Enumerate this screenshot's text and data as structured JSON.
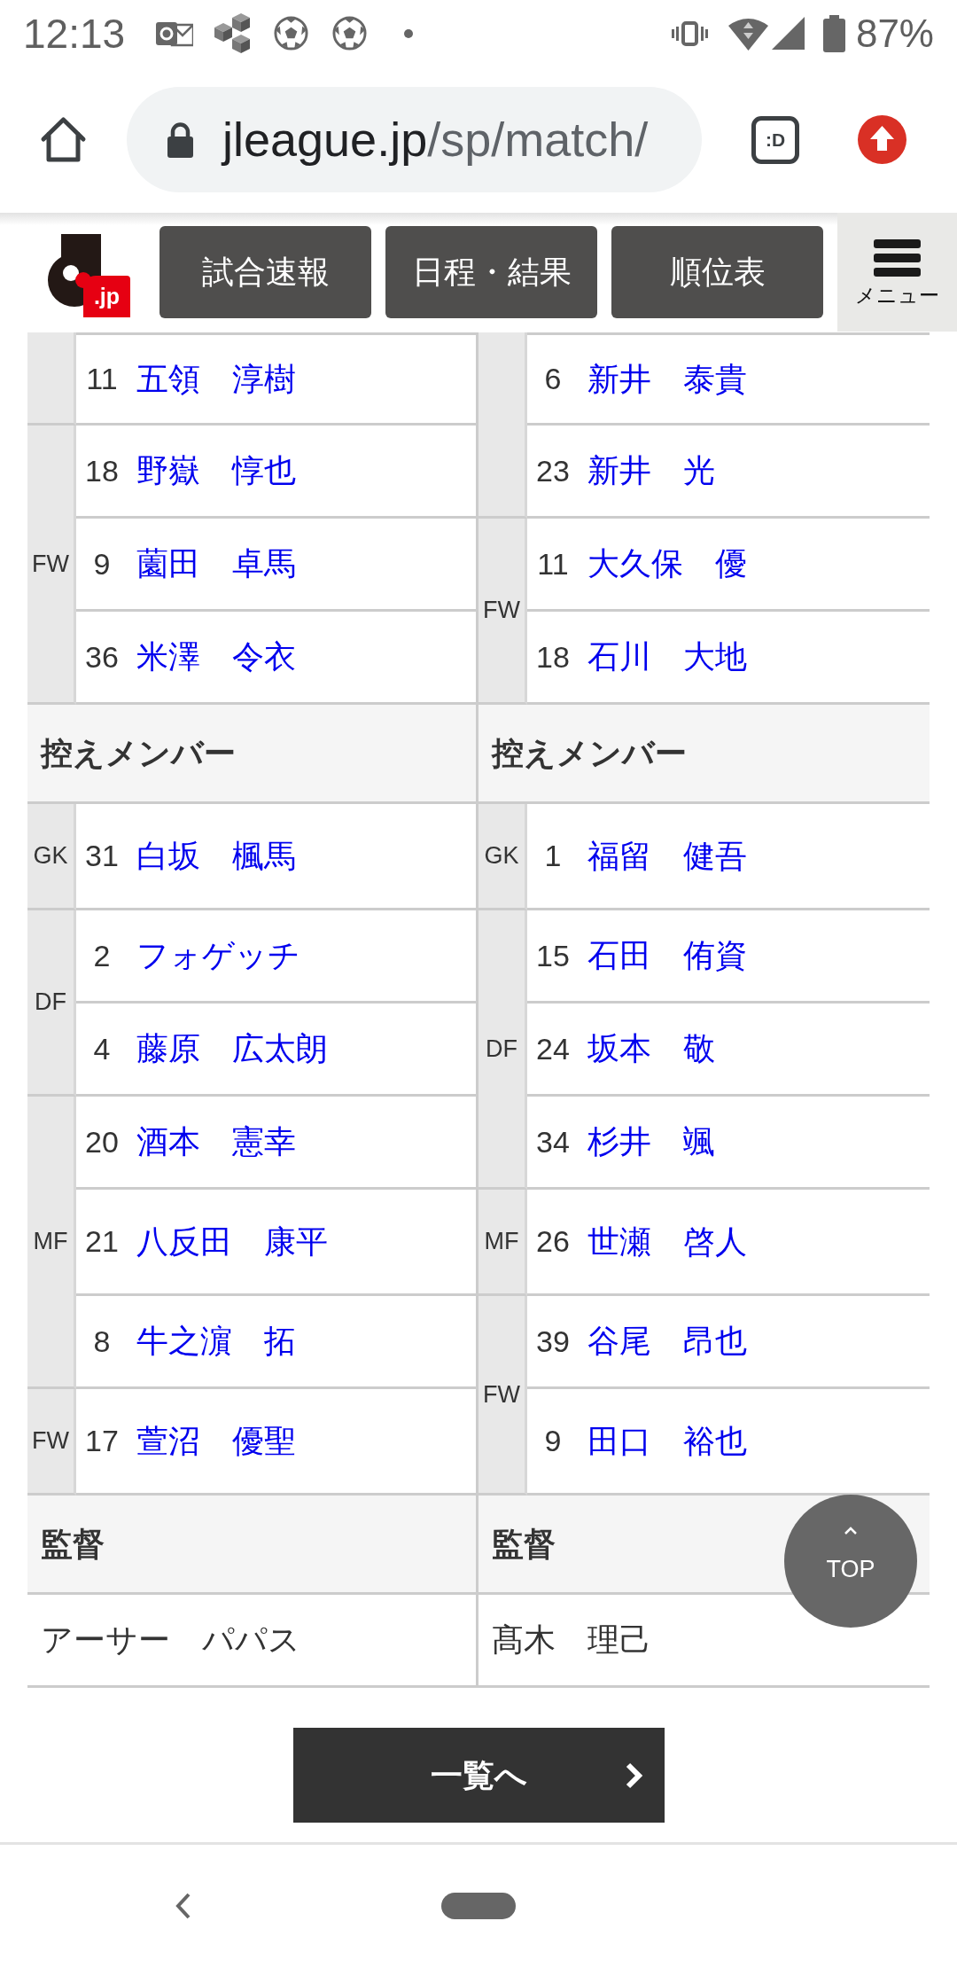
{
  "status_bar": {
    "time": "12:13",
    "battery": "87%"
  },
  "browser": {
    "url_host": "jleague.jp",
    "url_path": "/sp/match/",
    "tab_switcher": ":D"
  },
  "site_header": {
    "logo_text": ".jp",
    "nav": [
      "試合速報",
      "日程・結果",
      "順位表"
    ],
    "menu_label": "メニュー"
  },
  "lineup": {
    "starters": {
      "home": [
        {
          "players": [
            {
              "number": "11",
              "name": "五領　淳樹"
            }
          ]
        },
        {
          "position": "FW",
          "players": [
            {
              "number": "18",
              "name": "野嶽　惇也"
            },
            {
              "number": "9",
              "name": "薗田　卓馬"
            },
            {
              "number": "36",
              "name": "米澤　令衣"
            }
          ]
        }
      ],
      "away": [
        {
          "players": [
            {
              "number": "6",
              "name": "新井　泰貴"
            },
            {
              "number": "23",
              "name": "新井　光"
            }
          ]
        },
        {
          "position": "FW",
          "players": [
            {
              "number": "11",
              "name": "大久保　優"
            },
            {
              "number": "18",
              "name": "石川　大地"
            }
          ]
        }
      ]
    },
    "substitutes": {
      "home_title": "控えメンバー",
      "away_title": "控えメンバー",
      "home": [
        {
          "position": "GK",
          "players": [
            {
              "number": "31",
              "name": "白坂　楓馬"
            }
          ]
        },
        {
          "position": "DF",
          "players": [
            {
              "number": "2",
              "name": "フォゲッチ"
            },
            {
              "number": "4",
              "name": "藤原　広太朗"
            }
          ]
        },
        {
          "position": "MF",
          "players": [
            {
              "number": "20",
              "name": "酒本　憲幸"
            },
            {
              "number": "21",
              "name": "八反田　康平"
            },
            {
              "number": "8",
              "name": "牛之濵　拓"
            }
          ]
        },
        {
          "position": "FW",
          "players": [
            {
              "number": "17",
              "name": "萱沼　優聖"
            }
          ]
        }
      ],
      "away": [
        {
          "position": "GK",
          "players": [
            {
              "number": "1",
              "name": "福留　健吾"
            }
          ]
        },
        {
          "position": "DF",
          "players": [
            {
              "number": "15",
              "name": "石田　侑資"
            },
            {
              "number": "24",
              "name": "坂本　敬"
            },
            {
              "number": "34",
              "name": "杉井　颯"
            }
          ]
        },
        {
          "position": "MF",
          "players": [
            {
              "number": "26",
              "name": "世瀬　啓人"
            }
          ]
        },
        {
          "position": "FW",
          "players": [
            {
              "number": "39",
              "name": "谷尾　昂也"
            },
            {
              "number": "9",
              "name": "田口　裕也"
            }
          ]
        }
      ]
    },
    "managers": {
      "home_title": "監督",
      "away_title": "監督",
      "home": "アーサー　パパス",
      "away": "髙木　理己"
    }
  },
  "list_button": {
    "label": "一覧へ"
  },
  "top_button": {
    "label": "TOP"
  }
}
